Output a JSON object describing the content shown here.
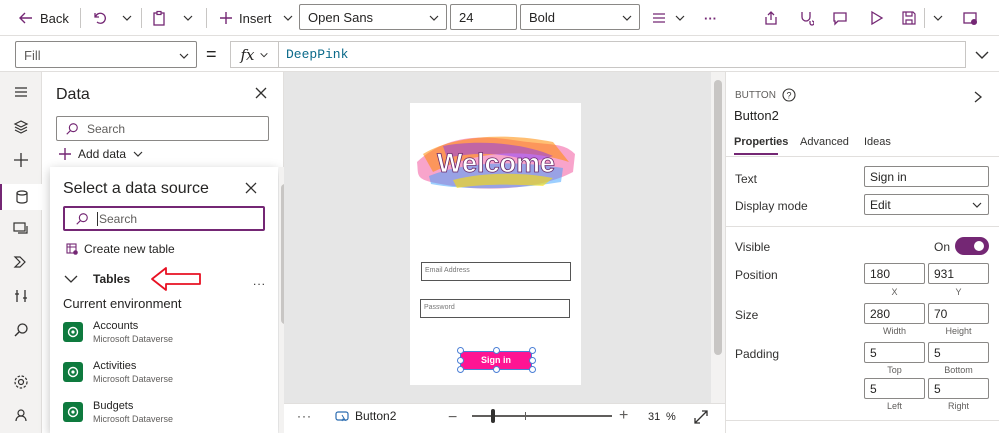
{
  "toolbar": {
    "back_label": "Back",
    "insert_label": "Insert",
    "font_family": "Open Sans",
    "font_size": "24",
    "font_weight": "Bold",
    "more": "···"
  },
  "formula_bar": {
    "property": "Fill",
    "equals": "=",
    "fx": "fx",
    "value": "DeepPink"
  },
  "data_panel": {
    "title": "Data",
    "search_placeholder": "Search",
    "add_data": "Add data"
  },
  "data_source_popup": {
    "title": "Select a data source",
    "search_placeholder": "Search",
    "create_table": "Create new table",
    "section": "Tables",
    "section_more": "...",
    "group": "Current environment",
    "items": [
      {
        "name": "Accounts",
        "source": "Microsoft Dataverse"
      },
      {
        "name": "Activities",
        "source": "Microsoft Dataverse"
      },
      {
        "name": "Budgets",
        "source": "Microsoft Dataverse"
      }
    ]
  },
  "canvas": {
    "welcome_text": "Welcome",
    "email_placeholder": "Email Address",
    "password_placeholder": "Password",
    "signin_label": "Sign in",
    "signin_color": "#FF1493"
  },
  "status_bar": {
    "more": "···",
    "control_name": "Button2",
    "zoom_value": "31",
    "zoom_unit": "%"
  },
  "properties_panel": {
    "control_type": "BUTTON",
    "control_name": "Button2",
    "tabs": [
      "Properties",
      "Advanced",
      "Ideas"
    ],
    "text_label": "Text",
    "text_value": "Sign in",
    "display_mode_label": "Display mode",
    "display_mode_value": "Edit",
    "visible_label": "Visible",
    "visible_value": "On",
    "position_label": "Position",
    "position_x": "180",
    "position_y": "931",
    "x_label": "X",
    "y_label": "Y",
    "size_label": "Size",
    "size_width": "280",
    "size_height": "70",
    "width_label": "Width",
    "height_label": "Height",
    "padding_label": "Padding",
    "padding_top": "5",
    "padding_bottom": "5",
    "padding_left": "5",
    "padding_right": "5",
    "top_label": "Top",
    "bottom_label": "Bottom",
    "left_label": "Left",
    "right_label": "Right"
  },
  "colors": {
    "accent": "#742774",
    "deeppink": "#FF1493",
    "dataverse": "#0E7A3E",
    "annotation_arrow": "#E81123"
  }
}
